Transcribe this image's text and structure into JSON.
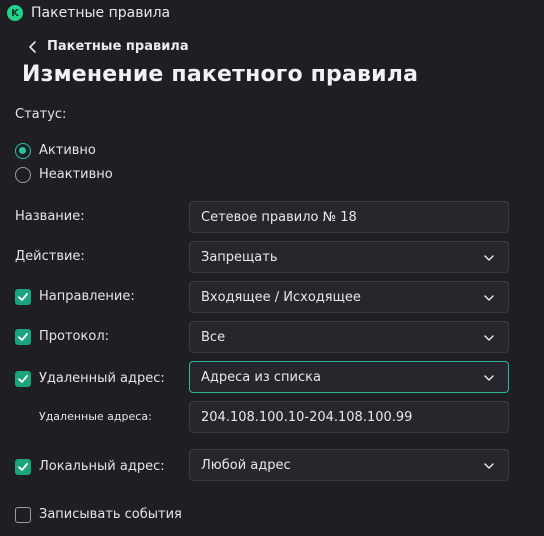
{
  "window": {
    "title": "Пакетные правила",
    "logo_letter": "K"
  },
  "breadcrumb": {
    "back_label": "Пакетные правила"
  },
  "page": {
    "title": "Изменение пакетного правила"
  },
  "status": {
    "label": "Статус:",
    "options": [
      {
        "label": "Активно",
        "checked": true
      },
      {
        "label": "Неактивно",
        "checked": false
      }
    ]
  },
  "form": {
    "name": {
      "label": "Название:",
      "value": "Сетевое правило № 18"
    },
    "action": {
      "label": "Действие:",
      "value": "Запрещать"
    },
    "direction": {
      "label": "Направление:",
      "value": "Входящее / Исходящее",
      "enabled": true
    },
    "protocol": {
      "label": "Протокол:",
      "value": "Все",
      "enabled": true
    },
    "remote_address": {
      "label": "Удаленный адрес:",
      "value": "Адреса из списка",
      "enabled": true
    },
    "remote_addresses": {
      "label": "Удаленные адреса:",
      "value": "204.108.100.10-204.108.100.99"
    },
    "local_address": {
      "label": "Локальный адрес:",
      "value": "Любой адрес",
      "enabled": true
    },
    "log_events": {
      "label": "Записывать события",
      "enabled": false
    }
  },
  "colors": {
    "accent": "#27c4a0",
    "checkbox": "#1ba57f",
    "background": "#1e1e23",
    "field": "#26262c"
  }
}
